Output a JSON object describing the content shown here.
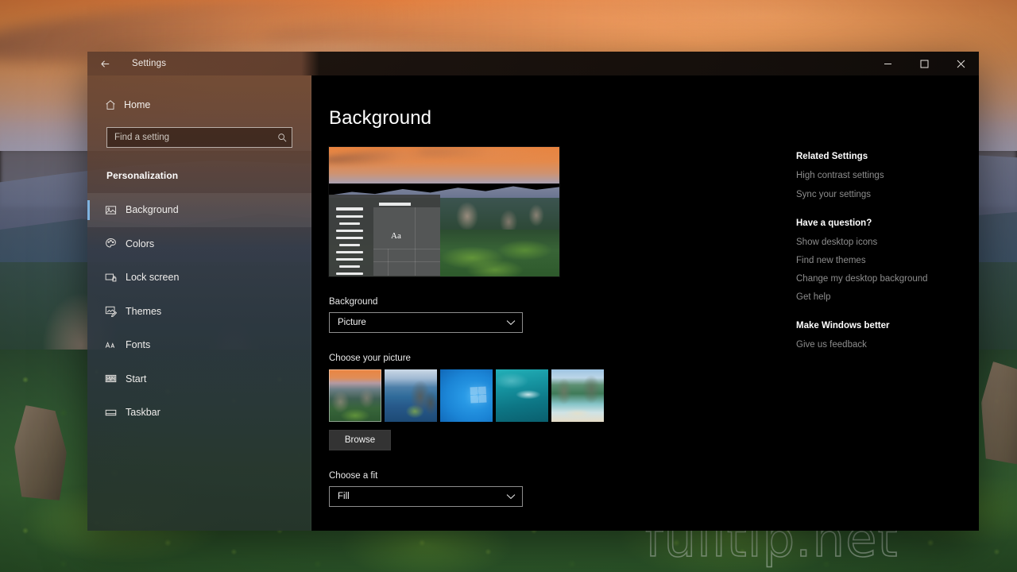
{
  "desktop": {
    "watermark": "fulltip.net"
  },
  "window": {
    "titlebar": {
      "back_icon": "back-arrow-icon",
      "title": "Settings",
      "minimize_label": "Minimize",
      "maximize_label": "Maximize",
      "close_label": "Close"
    }
  },
  "sidebar": {
    "home_label": "Home",
    "home_icon": "home-icon",
    "search": {
      "placeholder": "Find a setting",
      "value": "",
      "icon": "search-icon"
    },
    "section_title": "Personalization",
    "items": [
      {
        "label": "Background",
        "icon": "picture-icon",
        "selected": true
      },
      {
        "label": "Colors",
        "icon": "palette-icon",
        "selected": false
      },
      {
        "label": "Lock screen",
        "icon": "lock-screen-icon",
        "selected": false
      },
      {
        "label": "Themes",
        "icon": "themes-icon",
        "selected": false
      },
      {
        "label": "Fonts",
        "icon": "fonts-icon",
        "selected": false
      },
      {
        "label": "Start",
        "icon": "start-icon",
        "selected": false
      },
      {
        "label": "Taskbar",
        "icon": "taskbar-icon",
        "selected": false
      }
    ],
    "accent_color": "#7fb3e0"
  },
  "main": {
    "page_title": "Background",
    "preview": {
      "sample_text": "Aa"
    },
    "background_field": {
      "label": "Background",
      "value": "Picture",
      "chevron_icon": "chevron-down-icon"
    },
    "choose_picture": {
      "label": "Choose your picture",
      "thumbnails": [
        {
          "name": "sunset-cliffs-wallpaper",
          "selected": true
        },
        {
          "name": "blue-coast-cliffs-wallpaper",
          "selected": false
        },
        {
          "name": "windows-default-blue-wallpaper",
          "selected": false
        },
        {
          "name": "underwater-teal-wallpaper",
          "selected": false
        },
        {
          "name": "tropical-beach-wallpaper",
          "selected": false
        }
      ],
      "browse_label": "Browse"
    },
    "fit_field": {
      "label": "Choose a fit",
      "value": "Fill",
      "chevron_icon": "chevron-down-icon"
    }
  },
  "right_rail": {
    "related_settings": {
      "heading": "Related Settings",
      "links": [
        "High contrast settings",
        "Sync your settings"
      ]
    },
    "have_a_question": {
      "heading": "Have a question?",
      "links": [
        "Show desktop icons",
        "Find new themes",
        "Change my desktop background",
        "Get help"
      ]
    },
    "make_windows_better": {
      "heading": "Make Windows better",
      "links": [
        "Give us feedback"
      ]
    }
  }
}
